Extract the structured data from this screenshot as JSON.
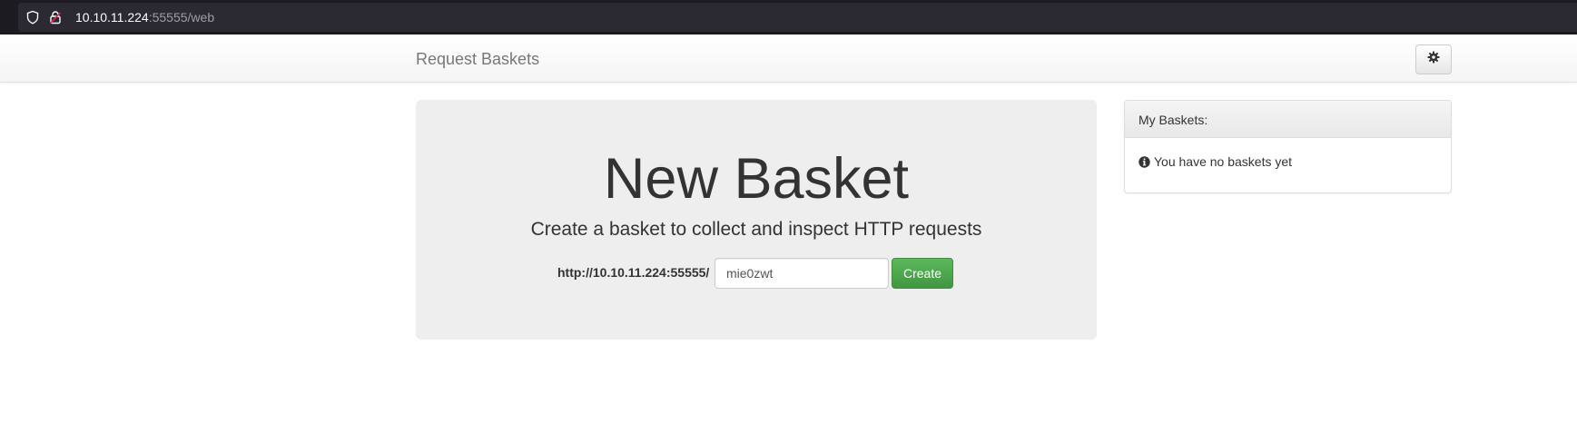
{
  "browser": {
    "url_host": "10.10.11.224",
    "url_rest": ":55555/web",
    "icons": [
      "shield-icon",
      "lock-icon"
    ]
  },
  "navbar": {
    "brand": "Request Baskets",
    "settings_icon": "gear-icon"
  },
  "main": {
    "title": "New Basket",
    "subtitle": "Create a basket to collect and inspect HTTP requests",
    "url_prefix": "http://10.10.11.224:55555/",
    "basket_name_value": "mie0zwt",
    "create_label": "Create"
  },
  "sidebar": {
    "heading": "My Baskets:",
    "empty_message": "You have no baskets yet",
    "info_icon": "info-circle-icon"
  },
  "colors": {
    "create_button": "#5cb85c",
    "jumbotron_bg": "#eeeeee",
    "browser_bg": "#2b2a33"
  }
}
